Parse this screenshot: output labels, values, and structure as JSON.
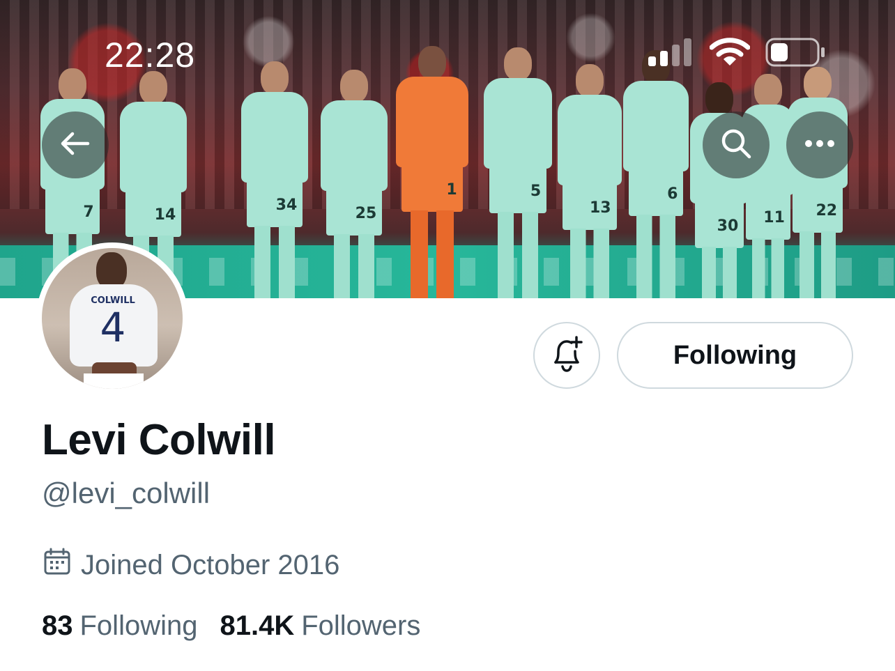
{
  "status_bar": {
    "time": "22:28",
    "icons": [
      "cellular-signal-icon",
      "wifi-icon",
      "battery-icon"
    ]
  },
  "banner": {
    "shirt_numbers": [
      "7",
      "14",
      "34",
      "25",
      "1",
      "5",
      "13",
      "6",
      "30",
      "11",
      "22"
    ]
  },
  "header_buttons": [
    "back-arrow-icon",
    "search-icon",
    "more-icon"
  ],
  "avatar": {
    "shirt_name": "COLWILL",
    "shirt_number": "4"
  },
  "actions": {
    "notification_icon": "bell-plus-icon",
    "following_label": "Following"
  },
  "profile": {
    "display_name": "Levi Colwill",
    "handle": "@levi_colwill",
    "joined_icon": "calendar-icon",
    "joined": "Joined October 2016",
    "following_count": "83",
    "following_label": "Following",
    "followers_count": "81.4K",
    "followers_label": "Followers"
  },
  "colors": {
    "primary_text": "#0f1419",
    "secondary_text": "#536471",
    "border": "#cfd9de",
    "background": "#ffffff"
  }
}
